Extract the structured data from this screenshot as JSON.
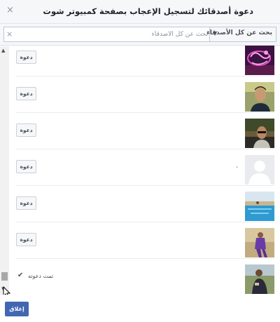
{
  "dialog": {
    "title": "دعوة أصدقائك لتسجيل الإعجاب بصفحة كمبيوتر شوت",
    "close_icon": "×"
  },
  "toolbar": {
    "filter_label": "بحث عن كل الأصدقاء",
    "filter_caret": "▼",
    "search_placeholder": "بحث عن كل الأصدقاء",
    "search_value": "",
    "clear_icon": "×"
  },
  "scrollbar": {
    "up_arrow": "▲",
    "down_arrow": "▼"
  },
  "friends": [
    {
      "button_label": "دعوة",
      "name": "",
      "photo": "neon-tattoo-photo"
    },
    {
      "button_label": "دعوة",
      "name": "",
      "photo": "man-selfie-photo"
    },
    {
      "button_label": "دعوة",
      "name": "",
      "photo": "man-car-photo"
    },
    {
      "button_label": "دعوة",
      "name": "،",
      "photo": "default-silhouette"
    },
    {
      "button_label": "دعوة",
      "name": "",
      "photo": "pool-photo"
    },
    {
      "button_label": "دعوة",
      "name": "",
      "photo": "man-standing-photo"
    },
    {
      "invited_label": "تمت دعوته",
      "check_icon": "✔",
      "photo": "man-outdoor-photo"
    }
  ],
  "footer": {
    "close_label": "إغلاق"
  },
  "colors": {
    "accent": "#4267b2",
    "header_bg": "#f6f7f9",
    "border": "#dddfe2"
  }
}
